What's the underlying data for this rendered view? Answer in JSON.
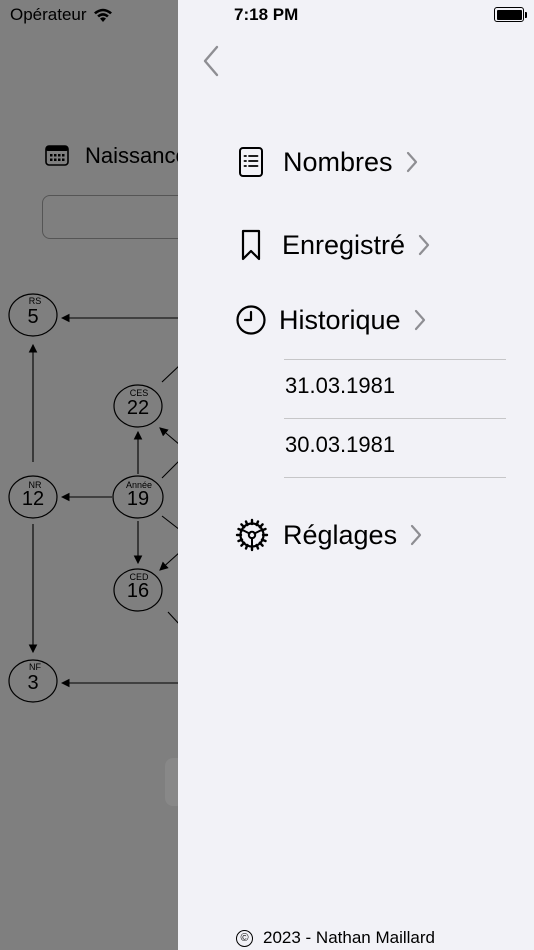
{
  "status_bar": {
    "carrier": "Opérateur",
    "time": "7:18 PM"
  },
  "background": {
    "date_label": "Naissance",
    "nodes": [
      {
        "label": "RS",
        "value": "5"
      },
      {
        "label": "CES",
        "value": "22"
      },
      {
        "label": "NR",
        "value": "12"
      },
      {
        "label": "Année",
        "value": "19"
      },
      {
        "label": "CED",
        "value": "16"
      },
      {
        "label": "NF",
        "value": "3"
      }
    ]
  },
  "drawer": {
    "menu": {
      "numbers": "Nombres",
      "saved": "Enregistré",
      "history": "Historique",
      "settings": "Réglages"
    },
    "history_items": [
      "31.03.1981",
      "30.03.1981"
    ],
    "footer": "2023 - Nathan Maillard",
    "footer_symbol": "©"
  }
}
